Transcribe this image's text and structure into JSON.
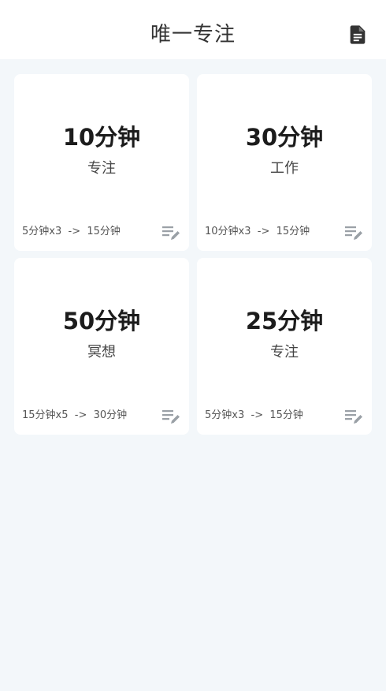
{
  "header": {
    "title": "唯一专注",
    "records_icon": "document-icon"
  },
  "cards": [
    {
      "duration": "10分钟",
      "label": "专注",
      "plan": "5分钟x3  ->  15分钟",
      "edit_icon": "playlist-edit-icon"
    },
    {
      "duration": "30分钟",
      "label": "工作",
      "plan": "10分钟x3  ->  15分钟",
      "edit_icon": "playlist-edit-icon"
    },
    {
      "duration": "50分钟",
      "label": "冥想",
      "plan": "15分钟x5  ->  30分钟",
      "edit_icon": "playlist-edit-icon"
    },
    {
      "duration": "25分钟",
      "label": "专注",
      "plan": "5分钟x3  ->  15分钟",
      "edit_icon": "playlist-edit-icon"
    }
  ],
  "colors": {
    "background": "#f3f7fa",
    "card": "#ffffff",
    "icon": "#9aa0a6",
    "header_icon": "#333333"
  }
}
